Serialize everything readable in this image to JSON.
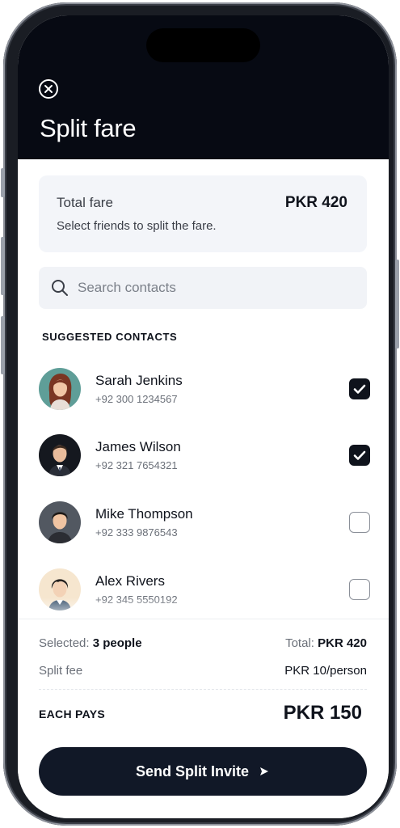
{
  "header": {
    "title": "Split fare",
    "close_icon": "close-circle-icon"
  },
  "fare": {
    "label": "Total fare",
    "amount": "PKR 420",
    "hint": "Select friends to split the fare."
  },
  "search": {
    "placeholder": "Search contacts",
    "value": "",
    "icon": "search-icon"
  },
  "contacts_section": {
    "title": "SUGGESTED CONTACTS",
    "items": [
      {
        "name": "Sarah Jenkins",
        "phone": "+92 300 1234567",
        "selected": true
      },
      {
        "name": "James Wilson",
        "phone": "+92 321 7654321",
        "selected": true
      },
      {
        "name": "Mike Thompson",
        "phone": "+92 333 9876543",
        "selected": false
      },
      {
        "name": "Alex Rivers",
        "phone": "+92 345 5550192",
        "selected": false
      }
    ]
  },
  "summary": {
    "selected_label": "Selected:",
    "selected_value": "3 people",
    "total_label": "Total:",
    "total_value": "PKR 420",
    "split_fee_label": "Split fee",
    "split_fee_value": "PKR 10/person",
    "each_pays_label": "EACH PAYS",
    "each_pays_value": "PKR 150"
  },
  "cta": {
    "label": "Send Split Invite",
    "icon": "send-arrow-icon"
  },
  "colors": {
    "header_bg": "#070a13",
    "accent": "#111827",
    "card_bg": "#f3f5f9"
  }
}
